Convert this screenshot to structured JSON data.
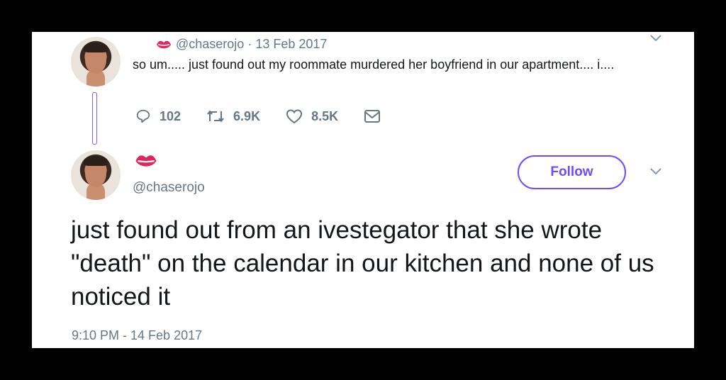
{
  "tweet1": {
    "handle": "@chaserojo",
    "separator": "·",
    "date": "13 Feb 2017",
    "text": "so um..... just found out my roommate murdered her boyfriend in our apartment.... i....",
    "replies": "102",
    "retweets": "6.9K",
    "likes": "8.5K"
  },
  "tweet2": {
    "handle": "@chaserojo",
    "follow_label": "Follow",
    "text": "just found out from an ivestegator that she wrote \"death\" on the calendar in our kitchen and none of us noticed it",
    "timestamp": "9:10 PM - 14 Feb 2017"
  },
  "colors": {
    "accent": "#6e4bff",
    "muted": "#657786",
    "text": "#14171a",
    "lips": "#e0245e"
  },
  "icons": [
    "lips-icon",
    "reply-icon",
    "retweet-icon",
    "like-icon",
    "message-icon",
    "chevron-down-icon"
  ]
}
